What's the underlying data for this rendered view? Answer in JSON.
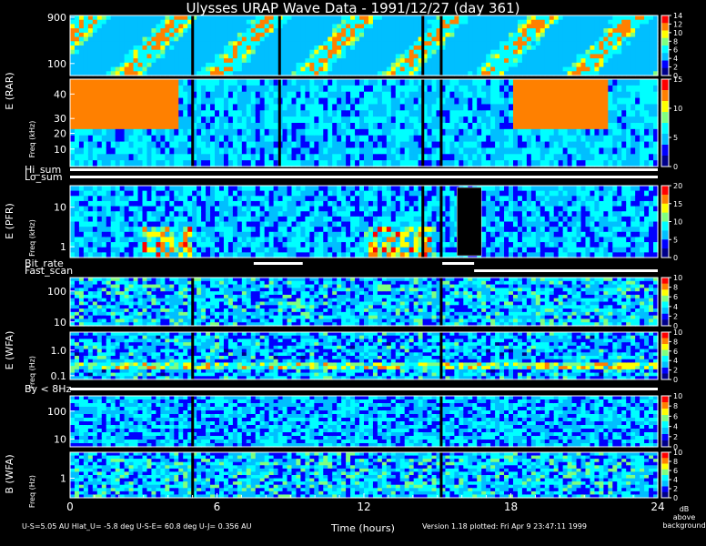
{
  "title": "Ulysses URAP Wave Data - 1991/12/27  (day 361)",
  "footer": {
    "ephemeris": "U-S=5.05 AU  Hlat_U= -5.8 deg  U-S-E= 60.8 deg  U-J= 0.356 AU",
    "xlabel": "Time (hours)",
    "version": "Version 1.18 plotted: Fri Apr  9 23:47:11 1999"
  },
  "colorbar_unit": [
    "dB",
    "above",
    "background"
  ],
  "chart_data": {
    "type": "heatmap",
    "title": "Ulysses URAP Wave Data - 1991/12/27  (day 361)",
    "xlabel": "Time (hours)",
    "xlim": [
      0,
      24
    ],
    "xticks": [
      "0",
      "6",
      "12",
      "18",
      "24"
    ],
    "colormap": [
      "#00008b",
      "#0000ff",
      "#00bfff",
      "#00ffff",
      "#7fff7f",
      "#ffff00",
      "#ff8000",
      "#ff0000"
    ],
    "panels": [
      {
        "id": "rar-high",
        "group_label": "E (RAR)",
        "axis_label": "",
        "yticks": [
          "900",
          "100"
        ],
        "cbar_ticks": [
          "14",
          "12",
          "10",
          "8",
          "6",
          "4",
          "2",
          "0"
        ],
        "cbar_max": 14,
        "gaps": [
          4.95,
          8.5,
          14.35,
          15.1
        ]
      },
      {
        "id": "rar-low",
        "group_label": "",
        "axis_label": "Freq (kHz)",
        "yticks": [
          "40",
          "30",
          "20",
          "10"
        ],
        "cbar_ticks": [
          "15",
          "10",
          "5",
          "0"
        ],
        "cbar_max": 15,
        "gaps": [
          4.95,
          8.5,
          14.35,
          15.1
        ]
      },
      {
        "id": "pfr",
        "group_label": "E (PFR)",
        "axis_label": "Freq (kHz)",
        "yticks": [
          "10",
          "1"
        ],
        "cbar_ticks": [
          "20",
          "15",
          "10",
          "5",
          "0"
        ],
        "cbar_max": 20,
        "gaps": [
          14.35,
          15.1
        ]
      },
      {
        "id": "wfa-e-high",
        "group_label": "E (WFA)",
        "axis_label": "",
        "yticks": [
          "100",
          "10"
        ],
        "cbar_ticks": [
          "10",
          "8",
          "6",
          "4",
          "2",
          "0"
        ],
        "cbar_max": 10,
        "gaps": [
          4.95,
          15.1
        ]
      },
      {
        "id": "wfa-e-low",
        "group_label": "",
        "axis_label": "Freq (Hz)",
        "yticks": [
          "1.0",
          "0.1"
        ],
        "cbar_ticks": [
          "10",
          "8",
          "6",
          "4",
          "2",
          "0"
        ],
        "cbar_max": 10,
        "gaps": [
          4.95,
          15.1
        ]
      },
      {
        "id": "wfa-b-high",
        "group_label": "B (WFA)",
        "axis_label": "",
        "yticks": [
          "100",
          "10"
        ],
        "cbar_ticks": [
          "10",
          "8",
          "6",
          "4",
          "2",
          "0"
        ],
        "cbar_max": 10,
        "gaps": [
          4.95,
          15.1
        ]
      },
      {
        "id": "wfa-b-low",
        "group_label": "",
        "axis_label": "Freq (Hz)",
        "yticks": [
          "1"
        ],
        "cbar_ticks": [
          "10",
          "8",
          "6",
          "4",
          "2",
          "0"
        ],
        "cbar_max": 10,
        "gaps": [
          4.95,
          15.1
        ]
      }
    ],
    "strips": [
      {
        "label": "Hi_sum",
        "segments": [
          [
            0,
            24
          ]
        ]
      },
      {
        "label": "Lo_sum",
        "segments": [
          [
            0,
            24
          ]
        ]
      },
      {
        "label": "Bit_rate",
        "segments": [
          [
            7.5,
            9.5
          ],
          [
            15.2,
            16.5
          ]
        ]
      },
      {
        "label": "Fast_scan",
        "segments": [
          [
            16.5,
            24
          ]
        ]
      },
      {
        "label": "By < 8Hz",
        "segments": [
          [
            0,
            24
          ]
        ]
      }
    ],
    "data_gap_box": {
      "panel": "pfr",
      "x": [
        15.8,
        16.8
      ]
    }
  }
}
